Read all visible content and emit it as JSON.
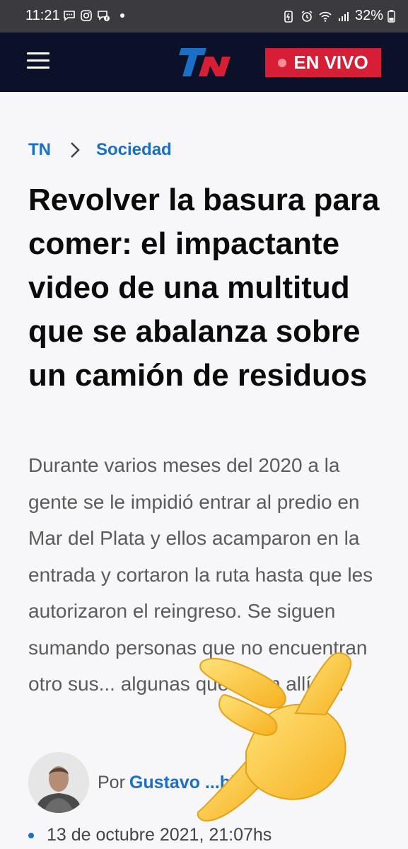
{
  "status_bar": {
    "time": "11:21",
    "battery": "32%",
    "left_icons": [
      "chat-bubble-icon",
      "instagram-icon",
      "messenger-icon",
      "dot-icon"
    ],
    "right_icons": [
      "battery-saver-icon",
      "alarm-icon",
      "wifi-icon",
      "signal-icon",
      "battery-icon"
    ]
  },
  "header": {
    "logo_text": "TN",
    "live_label": "EN VIVO",
    "colors": {
      "background": "#0a1128",
      "logo": "#1a6fc9",
      "live": "#d61f36"
    }
  },
  "breadcrumb": {
    "home": "TN",
    "section": "Sociedad"
  },
  "article": {
    "title": "Revolver la basura para comer: el impactante video de una multitud que se abalanza sobre un camión de residuos",
    "lead": "Durante varios meses del 2020 a la gente se le impidió entrar al predio en Mar del Plata y ellos acamparon en la entrada y cortaron la ruta hasta que les autorizaron el reingreso. Se siguen sumando personas que no encuentran otro sus... algunas que viven allí a...",
    "byline_prefix": "Por",
    "author": "Gustavo ...bio",
    "date": "13 de octubre 2021, 21:07hs"
  },
  "overlay": {
    "emoji": "pointing-hand-emoji"
  }
}
